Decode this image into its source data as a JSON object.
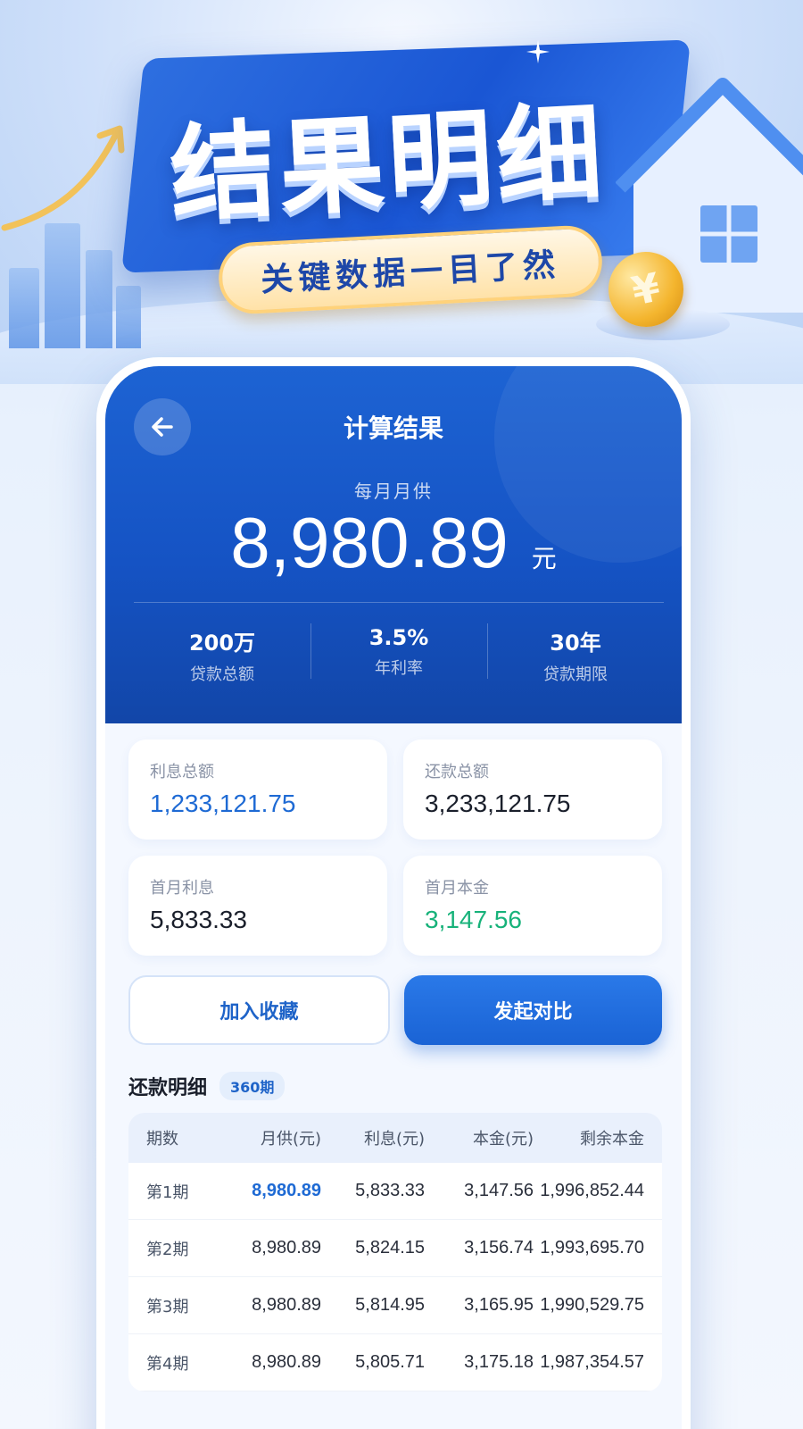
{
  "hero": {
    "title": "结果明细",
    "subtitle": "关键数据一目了然",
    "coin_symbol": "¥"
  },
  "header": {
    "title": "计算结果",
    "monthly_label": "每月月供",
    "monthly_amount": "8,980.89",
    "monthly_unit": "元",
    "stats": [
      {
        "value": "200万",
        "label": "贷款总额"
      },
      {
        "value": "3.5%",
        "label": "年利率"
      },
      {
        "value": "30年",
        "label": "贷款期限"
      }
    ]
  },
  "cards": [
    {
      "label": "利息总额",
      "value": "1,233,121.75",
      "color": "#1e6ad4"
    },
    {
      "label": "还款总额",
      "value": "3,233,121.75",
      "color": "#1a1f2b"
    },
    {
      "label": "首月利息",
      "value": "5,833.33",
      "color": "#1a1f2b"
    },
    {
      "label": "首月本金",
      "value": "3,147.56",
      "color": "#17b27a"
    }
  ],
  "actions": {
    "favorite_label": "加入收藏",
    "compare_label": "发起对比"
  },
  "schedule": {
    "title": "还款明细",
    "badge": "360期",
    "columns": [
      "期数",
      "月供(元)",
      "利息(元)",
      "本金(元)",
      "剩余本金"
    ],
    "rows": [
      {
        "period": "第1期",
        "payment": "8,980.89",
        "interest": "5,833.33",
        "principal": "3,147.56",
        "remaining": "1,996,852.44"
      },
      {
        "period": "第2期",
        "payment": "8,980.89",
        "interest": "5,824.15",
        "principal": "3,156.74",
        "remaining": "1,993,695.70"
      },
      {
        "period": "第3期",
        "payment": "8,980.89",
        "interest": "5,814.95",
        "principal": "3,165.95",
        "remaining": "1,990,529.75"
      },
      {
        "period": "第4期",
        "payment": "8,980.89",
        "interest": "5,805.71",
        "principal": "3,175.18",
        "remaining": "1,987,354.57"
      }
    ]
  },
  "colors": {
    "brand_blue": "#1553c4",
    "accent_blue": "#1e6ad4",
    "accent_green": "#17b27a",
    "gold": "#f4b52e"
  }
}
